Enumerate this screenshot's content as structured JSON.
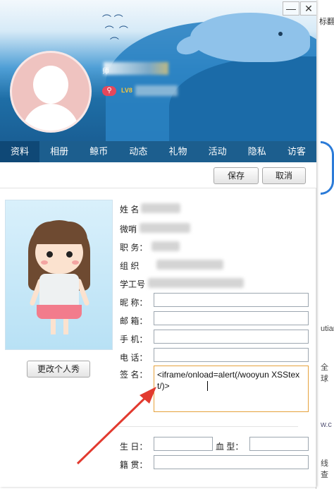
{
  "background_app": {
    "top_text": "标翻",
    "mid_text": "utian",
    "lower_text": "全球",
    "link_text": "w.c",
    "bottom_text": "线查"
  },
  "window": {
    "min_glyph": "—",
    "close_glyph": "✕"
  },
  "profile": {
    "nick_prefix": "师",
    "level_badge": "LV8"
  },
  "tabs": [
    "资料",
    "相册",
    "鲸币",
    "动态",
    "礼物",
    "活动",
    "隐私",
    "访客"
  ],
  "toolbar": {
    "save_label": "保存",
    "cancel_label": "取消"
  },
  "portrait": {
    "change_label": "更改个人秀"
  },
  "form": {
    "labels": {
      "name": "姓    名",
      "weishao": "微哨",
      "position": "职    务：",
      "org": "组    织",
      "student_id": "学工号",
      "nickname": "昵    称：",
      "email": "邮    箱：",
      "mobile": "手    机：",
      "phone": "电    话：",
      "signature": "签    名：",
      "birthday": "生    日：",
      "blood_type": "血    型：",
      "hometown": "籍    贯："
    },
    "signature_value": "<iframe/onload=alert(/wooyun XSStext/)>",
    "colors": {
      "signature_border": "#e6a23c",
      "tab_active": "#0f4876",
      "tabbar": "#1c5e8e",
      "annotation_arrow": "#e23a2f"
    }
  }
}
